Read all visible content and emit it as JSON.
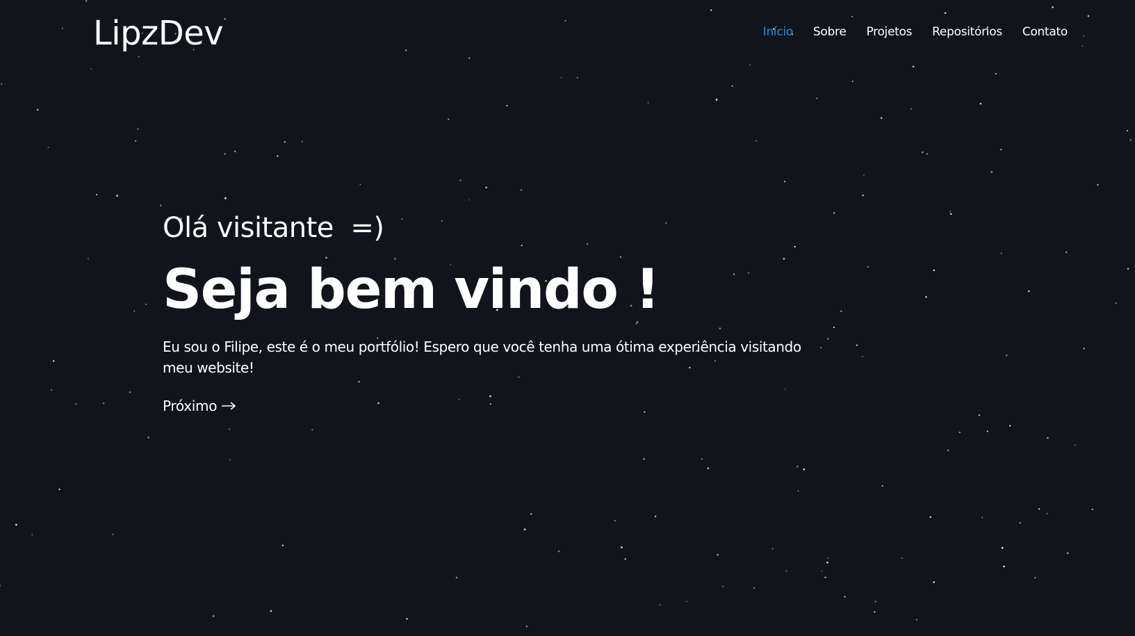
{
  "header": {
    "logo": "LipzDev",
    "nav": [
      {
        "label": "Início",
        "active": true
      },
      {
        "label": "Sobre",
        "active": false
      },
      {
        "label": "Projetos",
        "active": false
      },
      {
        "label": "Repositórios",
        "active": false
      },
      {
        "label": "Contato",
        "active": false
      }
    ]
  },
  "hero": {
    "greeting": "Olá visitante  =)",
    "title": "Seja bem vindo !",
    "description": "Eu sou o Filipe, este é o meu portfólio! Espero que você tenha uma ótima experiência visitando meu website!",
    "next_label": "Próximo",
    "next_icon": "arrow-right-icon"
  },
  "colors": {
    "background": "#12141b",
    "text": "#ffffff",
    "accent": "#1e8fe6",
    "star": "#e6e6e6"
  }
}
